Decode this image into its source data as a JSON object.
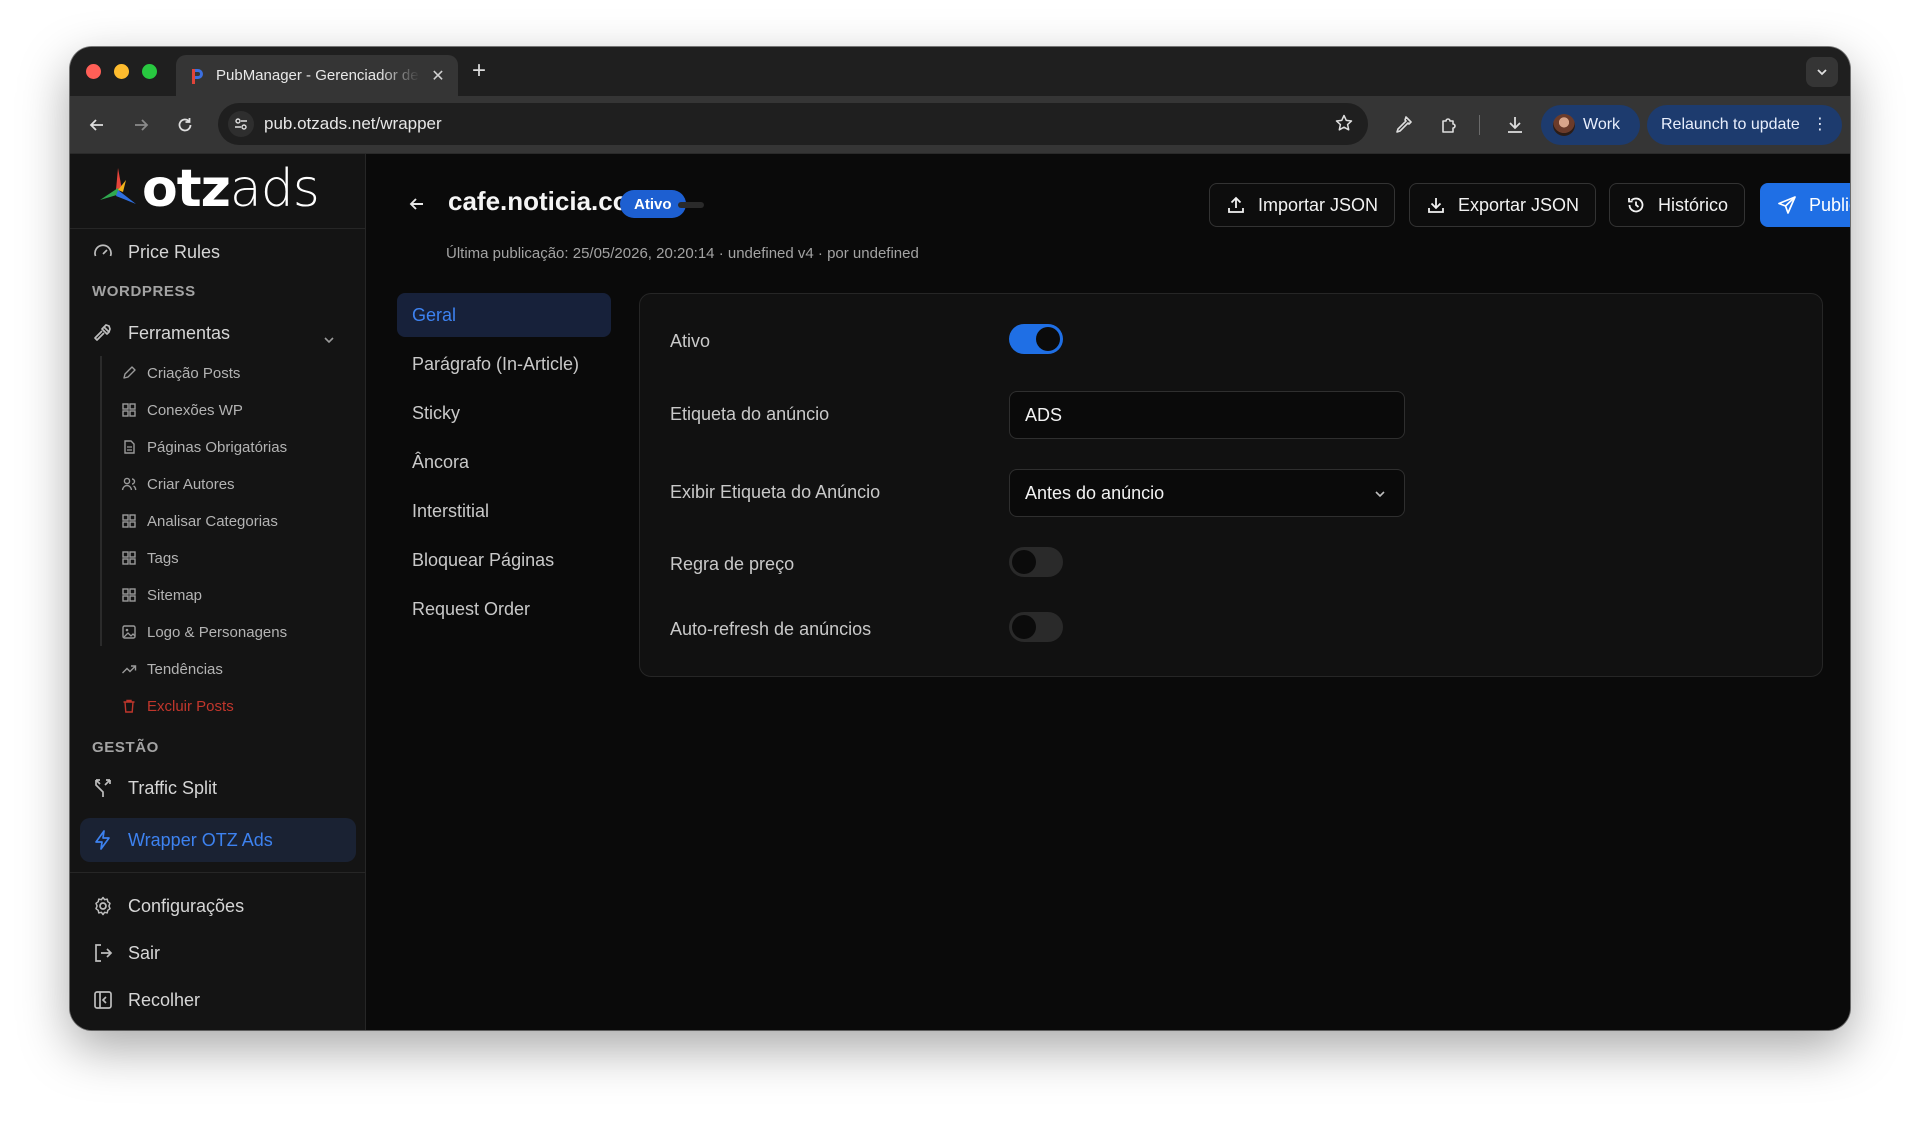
{
  "browser": {
    "tab_title": "PubManager - Gerenciador de",
    "tab_close": "✕",
    "new_tab": "+",
    "url": "pub.otzads.net/wrapper",
    "profile_label": "Work",
    "relaunch_label": "Relaunch to update",
    "relaunch_menu": "⋮"
  },
  "sidebar": {
    "logo_text": "otzads",
    "top_item": {
      "label": "Price Rules",
      "icon": "gauge-icon"
    },
    "section_wordpress": "WORDPRESS",
    "ferramentas": {
      "label": "Ferramentas",
      "icon": "hammer-icon",
      "expanded": true
    },
    "sub_items": [
      {
        "label": "Criação Posts",
        "icon": "pencil-icon"
      },
      {
        "label": "Conexões WP",
        "icon": "grid-icon"
      },
      {
        "label": "Páginas Obrigatórias",
        "icon": "file-icon"
      },
      {
        "label": "Criar Autores",
        "icon": "users-icon"
      },
      {
        "label": "Analisar Categorias",
        "icon": "grid-icon"
      },
      {
        "label": "Tags",
        "icon": "grid-icon"
      },
      {
        "label": "Sitemap",
        "icon": "grid-icon"
      },
      {
        "label": "Logo & Personagens",
        "icon": "image-icon"
      },
      {
        "label": "Tendências",
        "icon": "trending-up-icon"
      },
      {
        "label": "Excluir Posts",
        "icon": "trash-icon"
      }
    ],
    "section_gestao": "GESTÃO",
    "traffic_split": "Traffic Split",
    "wrapper": "Wrapper OTZ Ads",
    "configuracoes": "Configurações",
    "sair": "Sair",
    "recolher": "Recolher",
    "colors": {
      "active_bg": "#1a2233",
      "active_text": "#3d82f0",
      "danger": "#c0362c"
    }
  },
  "header": {
    "title": "cafe.noticia.com",
    "status": "Ativo",
    "subtitle": "Última publicação: 25/05/2026, 20:20:14 · undefined v4 · por undefined",
    "buttons": {
      "import": "Importar JSON",
      "export": "Exportar JSON",
      "history": "Histórico",
      "publish": "Publicar"
    }
  },
  "settings_nav": [
    {
      "label": "Geral",
      "active": true
    },
    {
      "label": "Parágrafo (In-Article)",
      "active": false
    },
    {
      "label": "Sticky",
      "active": false
    },
    {
      "label": "Âncora",
      "active": false
    },
    {
      "label": "Interstitial",
      "active": false
    },
    {
      "label": "Bloquear Páginas",
      "active": false
    },
    {
      "label": "Request Order",
      "active": false
    }
  ],
  "form": {
    "ativo": {
      "label": "Ativo",
      "checked": true
    },
    "etiqueta": {
      "label": "Etiqueta do anúncio",
      "value": "ADS"
    },
    "exibir": {
      "label": "Exibir Etiqueta do Anúncio",
      "selected": "Antes do anúncio"
    },
    "regra": {
      "label": "Regra de preço",
      "checked": false
    },
    "autorefresh": {
      "label": "Auto-refresh de anúncios",
      "checked": false
    }
  },
  "colors": {
    "accent": "#1f6fe5",
    "badge": "#1d5fd1",
    "background": "#0a0a0a"
  }
}
